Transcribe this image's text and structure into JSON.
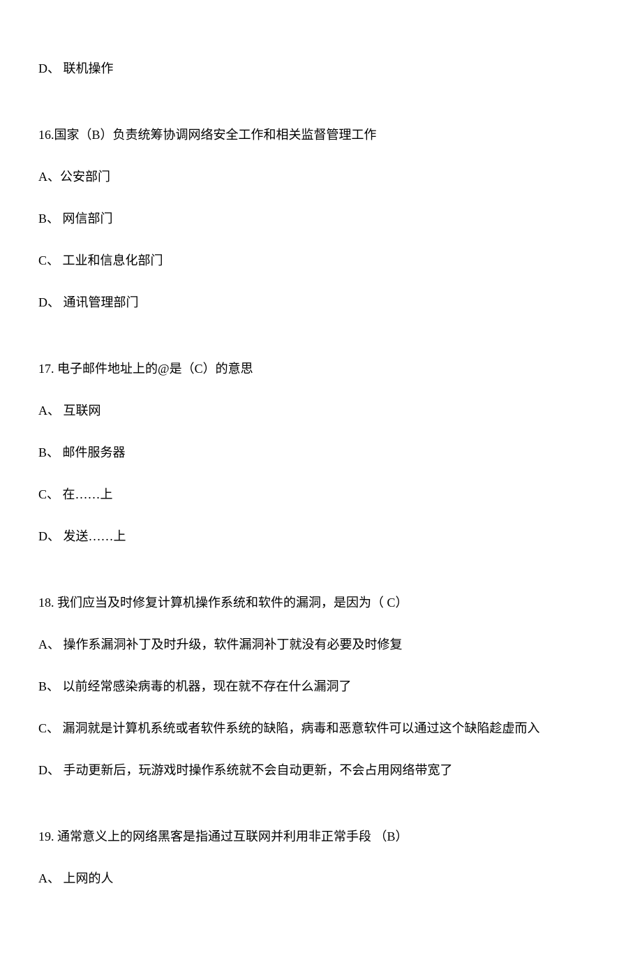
{
  "lines": {
    "l1": "D、 联机操作",
    "q16": "16.国家（B）负责统筹协调网络安全工作和相关监督管理工作",
    "q16a": "A、公安部门",
    "q16b": "B、 网信部门",
    "q16c": "C、 工业和信息化部门",
    "q16d": "D、 通讯管理部门",
    "q17": "17. 电子邮件地址上的@是（C）的意思",
    "q17a": "A、 互联网",
    "q17b": "B、 邮件服务器",
    "q17c": "C、 在……上",
    "q17d": "D、 发送……上",
    "q18": "18. 我们应当及时修复计算机操作系统和软件的漏洞，是因为（   C）",
    "q18a": "A、 操作系漏洞补丁及时升级，软件漏洞补丁就没有必要及时修复",
    "q18b": "B、 以前经常感染病毒的机器，现在就不存在什么漏洞了",
    "q18c": "C、 漏洞就是计算机系统或者软件系统的缺陷，病毒和恶意软件可以通过这个缺陷趁虚而入",
    "q18d": "D、 手动更新后，玩游戏时操作系统就不会自动更新，不会占用网络带宽了",
    "q19": "19. 通常意义上的网络黑客是指通过互联网并利用非正常手段   （B）",
    "q19a": "A、 上网的人"
  }
}
